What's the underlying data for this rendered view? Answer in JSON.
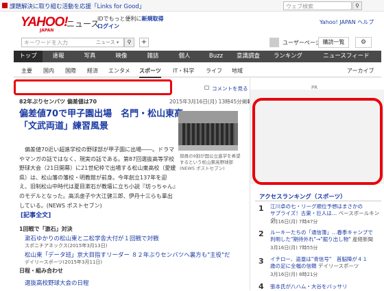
{
  "topbar": {
    "notice": "課題解決に取り組む活動を応援「Links for Good」",
    "web_search_placeholder": "ウェブ検索"
  },
  "header": {
    "logo": "YAHOO!",
    "logo_sub": "JAPAN",
    "service": "ニュース",
    "login_line1": "IDでもっと便利に",
    "login_link1": "新規取得",
    "login_link2": "ログイン",
    "help": "Yahoo! JAPAN  ヘルプ"
  },
  "toolbar": {
    "site_search_placeholder": "キーワードを入力",
    "site_search_scope": "ニュース ▾",
    "userpage": "ユーザーページ",
    "subscribe": "購読一覧"
  },
  "nav": {
    "items": [
      "トップ",
      "速報",
      "写真",
      "映像",
      "雑誌",
      "個人",
      "Buzz",
      "意識調査",
      "ランキング",
      "ニュースフィード"
    ],
    "active": "トップ"
  },
  "subnav": {
    "items": [
      "主要",
      "国内",
      "国際",
      "経済",
      "エンタメ",
      "スポーツ",
      "IT・科学",
      "ライフ",
      "地域"
    ],
    "active": "スポーツ",
    "archive": "アーカイブ"
  },
  "article": {
    "comment_link": "コメントを見る",
    "kicker": "82年ぶりセンバツ  偏差値は70",
    "date": "2015年3月16日(月) 13時45分掲載",
    "headline": "偏差値70で甲子園出場　名門・松山東高「文武両道」練習風景",
    "photo_caption": "部員の9割が国公立進学を希望するという松山東高野球部(NEWS ポストセブン)",
    "body": "　偏差値70近い超進学校の野球部が甲子園に出場――。ドラマやマンガの話ではなく、現実の話である。第87回選抜高等学校野球大会（21日開幕）に21世紀枠で出場する松山東高校（愛媛県）は、松山藩の藩校・明教館が前身。今年創立137年を迎え、旧制松山中時代は夏目漱石が教壇に立ち小説『坊っちゃん』のモデルとなった。高浜虚子や大江健三郎、伊丹十三らも輩出している。(NEWS ポストセブン)",
    "fulltext": "[記事全文]"
  },
  "related": {
    "group1_title": "1回戦で「激石」対決",
    "group1": [
      {
        "title": "漱石ゆかりの松山東と二松学舎大付が１回戦で対戦",
        "source": "スポニチアネックス(2015年3月13日)"
      },
      {
        "title": "松山東「データ班」京大目指すリーダー ８２年ぶりセンバツへ裏方も\"主役\"だ",
        "source": "デイリースポーツ(2015年3月11日)"
      }
    ],
    "group2_title": "日程・組み合わせ",
    "group2": [
      {
        "title": "選抜高校野球大会の日程",
        "source": ""
      }
    ]
  },
  "sidebar": {
    "pr": "PR",
    "ranking_title": "アクセスランキング（スポーツ）",
    "ranking": [
      {
        "num": "1",
        "title": "江川卓の七・リーグ順位予想はまさかの",
        "title2": "サプライズ！古巣・巨人は…",
        "source": "ベースボールキング",
        "time": "3月16日(月) 7時47分"
      },
      {
        "num": "2",
        "title": "ルーキーたちの「通信簿」…春季キャンプで",
        "title2": "判明した\"期待外れ\"→\"掘り出し物\"",
        "source": "産経新聞",
        "time": "3月16日(月) 7時55分"
      },
      {
        "num": "3",
        "title": "イチロー、盗塁は\"青信号\"　首脳陣が４１",
        "title2": "歳の足に全幅の信頼",
        "source": "デイリースポーツ",
        "time": "3月16日(月) 8時21分"
      },
      {
        "num": "4",
        "title": "張本氏が八ハム・大谷をバッサリ",
        "title2": "",
        "source": "",
        "time": ""
      }
    ]
  }
}
